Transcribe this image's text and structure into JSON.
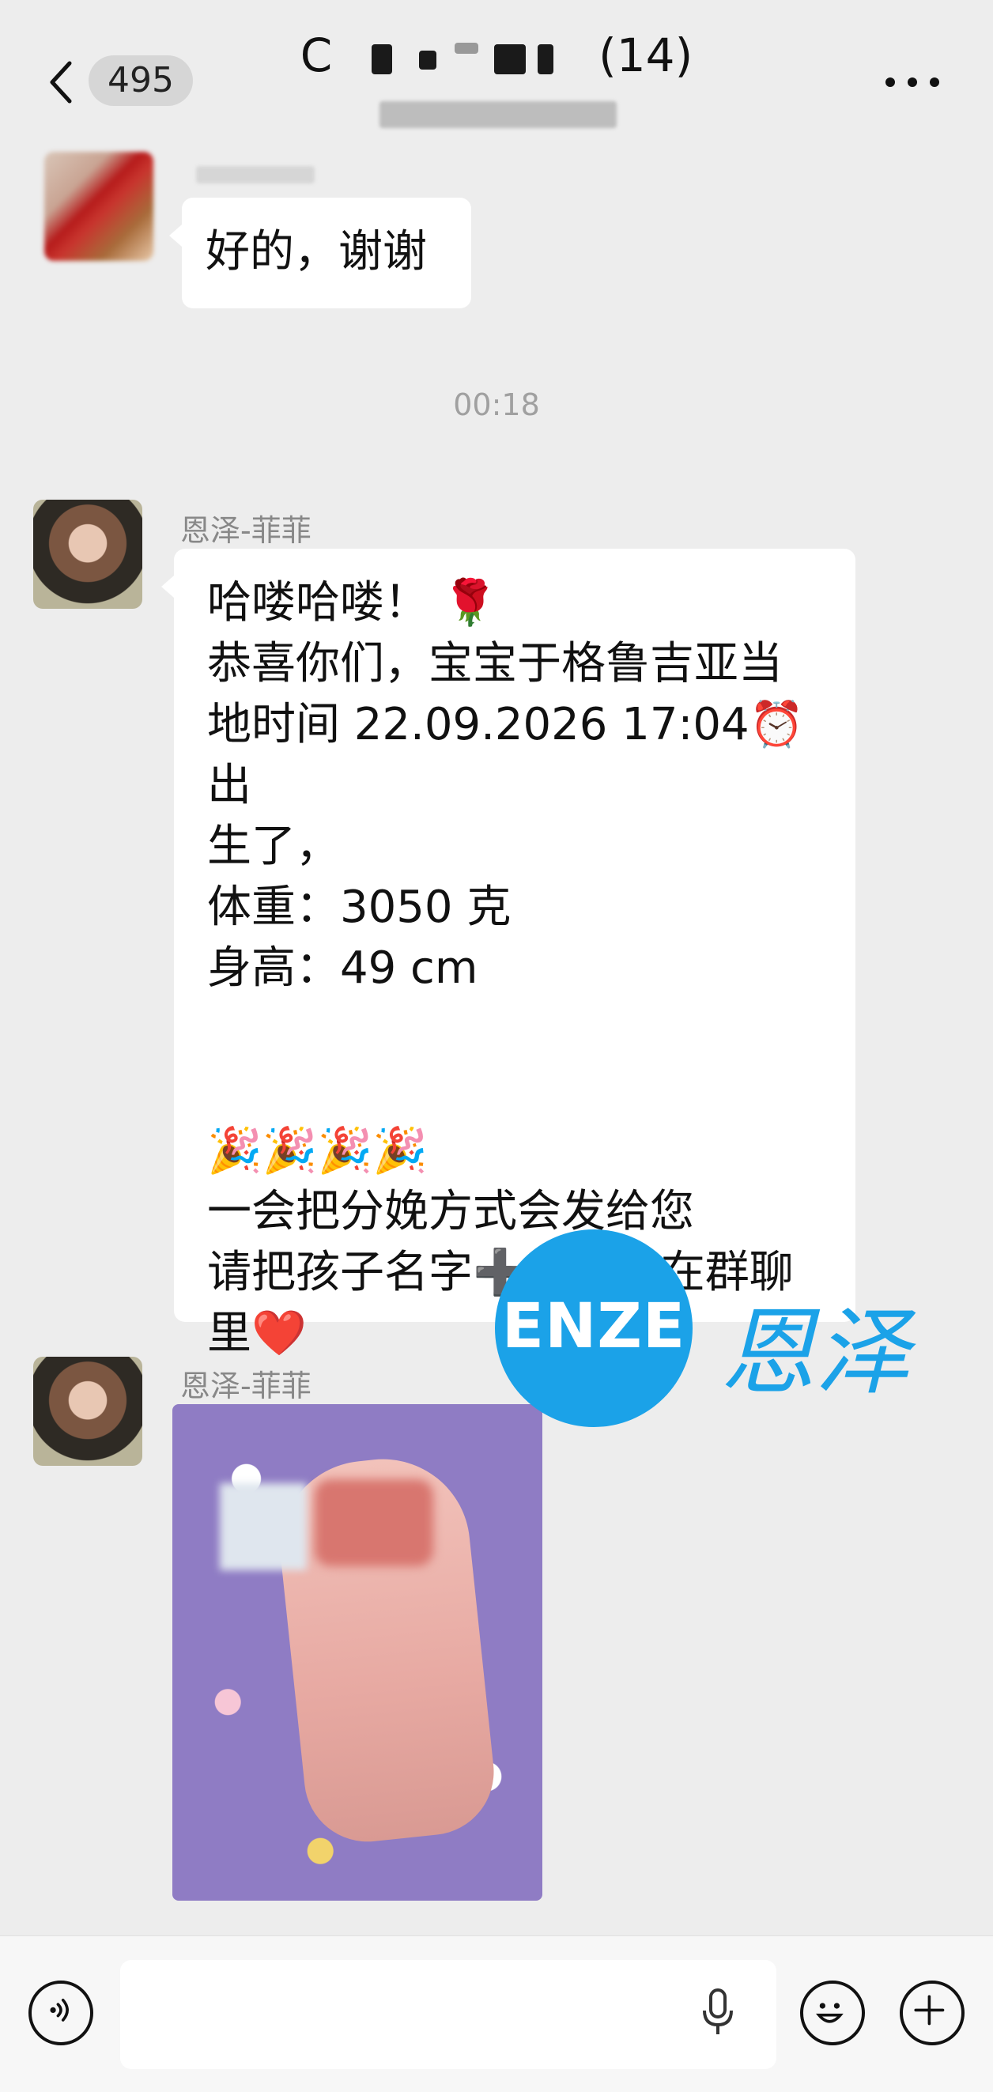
{
  "header": {
    "back_badge": "495",
    "title_prefix": "C",
    "title_suffix": "(14)"
  },
  "messages": {
    "msg1_text": "好的，谢谢",
    "time_label": "00:18",
    "msg2_sender": "恩泽-菲菲",
    "msg2_text": "哈喽哈喽！ 🌹\n恭喜你们，宝宝于格鲁吉亚当\n地时间 22.09.2026 17:04⏰出\n生了，\n体重：3050 克\n身高：49 cm\n\n\n🎉🎉🎉🎉\n一会把分娩方式会发给您\n请把孩子名字➕拼音发在群聊\n里❤️",
    "msg3_sender": "恩泽-菲菲"
  },
  "watermark": {
    "en": "ENZE",
    "cn": "恩泽",
    "color": "#1ba2e8"
  },
  "icons": {
    "back": "chevron-left-icon",
    "more": "more-dots-icon",
    "voice": "voice-icon",
    "mic": "mic-icon",
    "emoji": "emoji-icon",
    "add": "plus-icon"
  }
}
